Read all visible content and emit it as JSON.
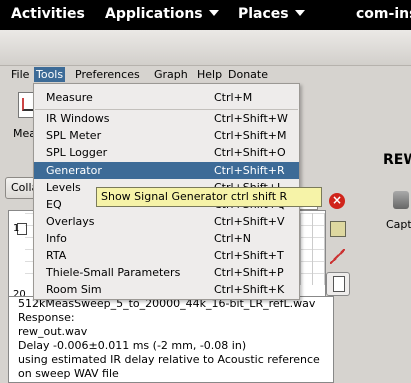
{
  "topbar": {
    "activities": "Activities",
    "applications": "Applications",
    "places": "Places",
    "window_name": "com-ins"
  },
  "menubar": {
    "items": [
      "File",
      "Tools",
      "Preferences",
      "Graph",
      "Help",
      "Donate"
    ]
  },
  "toolbar": {
    "measure_label": "Mea"
  },
  "tools_menu": {
    "items": [
      {
        "label": "Measure",
        "shortcut": "Ctrl+M"
      },
      {
        "label": "IR Windows",
        "shortcut": "Ctrl+Shift+W"
      },
      {
        "label": "SPL Meter",
        "shortcut": "Ctrl+Shift+M"
      },
      {
        "label": "SPL Logger",
        "shortcut": "Ctrl+Shift+O"
      },
      {
        "label": "Generator",
        "shortcut": "Ctrl+Shift+R"
      },
      {
        "label": "Levels",
        "shortcut": "Ctrl+Shift+L"
      },
      {
        "label": "EQ",
        "shortcut": "Ctrl+Shift+Q"
      },
      {
        "label": "Overlays",
        "shortcut": "Ctrl+Shift+V"
      },
      {
        "label": "Info",
        "shortcut": "Ctrl+N"
      },
      {
        "label": "RTA",
        "shortcut": "Ctrl+Shift+T"
      },
      {
        "label": "Thiele-Small Parameters",
        "shortcut": "Ctrl+Shift+P"
      },
      {
        "label": "Room Sim",
        "shortcut": "Ctrl+Shift+K"
      }
    ]
  },
  "tooltip": "Show Signal Generator  ctrl shift R",
  "main": {
    "rew_label": "REW",
    "coll_button": "Colla",
    "right_label": "Capt",
    "graph_y_top": "1",
    "graph_y_bottom": "20"
  },
  "log": [
    "512kMeasSweep_5_to_20000_44k_16-bit_LR_refL.wav",
    "Response:",
    "rew_out.wav",
    "Delay -0.006±0.011 ms (-2 mm, -0.08 in)",
    "using estimated IR delay relative to Acoustic reference",
    "on sweep WAV file"
  ]
}
